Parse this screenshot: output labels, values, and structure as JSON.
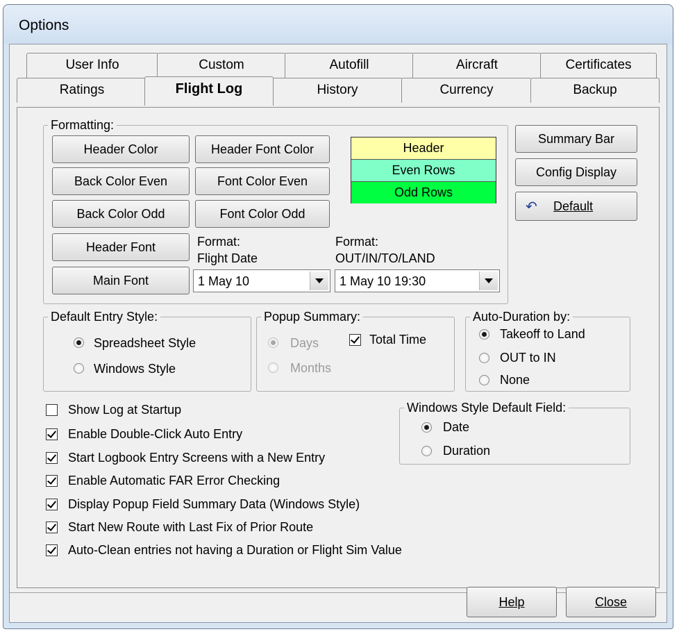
{
  "window": {
    "title": "Options"
  },
  "tabs_row1": [
    "User Info",
    "Custom",
    "Autofill",
    "Aircraft",
    "Certificates"
  ],
  "tabs_row2": [
    "Ratings",
    "Flight Log",
    "History",
    "Currency",
    "Backup"
  ],
  "active_tab": "Flight Log",
  "formatting": {
    "legend": "Formatting:",
    "header_color": "Header Color",
    "header_font_color": "Header Font Color",
    "back_color_even": "Back Color Even",
    "font_color_even": "Font Color Even",
    "back_color_odd": "Back Color Odd",
    "font_color_odd": "Font Color Odd",
    "header_font": "Header Font",
    "main_font": "Main Font",
    "date_format_label_1": "Format:",
    "date_format_label_2": "Flight Date",
    "date_format_value": "1 May 10",
    "time_format_label_1": "Format:",
    "time_format_label_2": "OUT/IN/TO/LAND",
    "time_format_value": "1 May 10 19:30",
    "preview": {
      "header": "Header",
      "even": "Even Rows",
      "odd": "Odd Rows",
      "header_color": "#ffffa8",
      "even_color": "#80ffc8",
      "odd_color": "#00ff40"
    }
  },
  "side_buttons": {
    "summary_bar": "Summary Bar",
    "config_display": "Config Display",
    "default": "Default"
  },
  "entry_style": {
    "legend": "Default Entry Style:",
    "spreadsheet": "Spreadsheet Style",
    "windows": "Windows Style",
    "selected": "spreadsheet"
  },
  "popup_summary": {
    "legend": "Popup Summary:",
    "days": "Days",
    "months": "Months",
    "total_time": "Total Time",
    "total_time_checked": true
  },
  "auto_duration": {
    "legend": "Auto-Duration by:",
    "takeoff": "Takeoff to Land",
    "out_in": "OUT to IN",
    "none": "None",
    "selected": "takeoff"
  },
  "windows_default_field": {
    "legend": "Windows Style Default Field:",
    "date": "Date",
    "duration": "Duration",
    "selected": "date"
  },
  "checkboxes": [
    {
      "label": "Show Log at Startup",
      "checked": false
    },
    {
      "label": "Enable Double-Click Auto Entry",
      "checked": true
    },
    {
      "label": "Start Logbook Entry Screens with a New Entry",
      "checked": true
    },
    {
      "label": "Enable Automatic FAR Error Checking",
      "checked": true
    },
    {
      "label": "Display Popup Field Summary Data (Windows Style)",
      "checked": true
    },
    {
      "label": "Start New Route with Last Fix of Prior Route",
      "checked": true
    },
    {
      "label": "Auto-Clean entries not having a Duration or Flight Sim Value",
      "checked": true
    }
  ],
  "footer": {
    "help": "Help",
    "close": "Close"
  }
}
